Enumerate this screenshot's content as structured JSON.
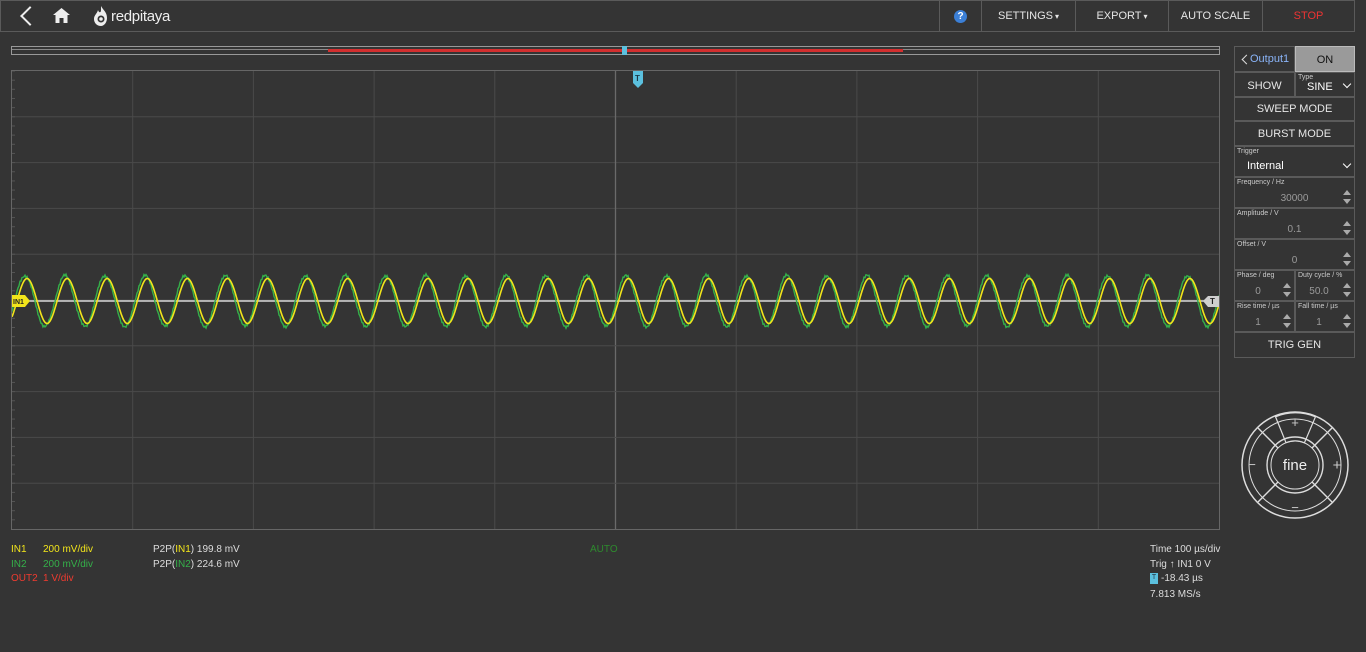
{
  "toolbar": {
    "logo_text": "redpitaya",
    "help_label": "?",
    "settings_label": "SETTINGS",
    "export_label": "EXPORT",
    "autoscale_label": "AUTO SCALE",
    "stop_label": "STOP",
    "caret": "▾"
  },
  "plot": {
    "trigger_marker_label": "T",
    "in1_marker_label": "IN1",
    "level_marker_label": "T",
    "mode_label": "AUTO",
    "colors": {
      "in1": "#f2e51b",
      "in2": "#34b04a",
      "out2": "#ef3b30",
      "grid": "#4a4a4a",
      "baseline": "#d8d8d8"
    }
  },
  "channels": [
    {
      "name": "IN1",
      "scale": "200 mV/div"
    },
    {
      "name": "IN2",
      "scale": "200 mV/div"
    },
    {
      "name": "OUT2",
      "scale": "1 V/div"
    }
  ],
  "measurements": [
    {
      "prefix": "P2P(",
      "channel": "IN1",
      "suffix": ")",
      "value": "199.8 mV"
    },
    {
      "prefix": "P2P(",
      "channel": "IN2",
      "suffix": ")",
      "value": "224.6 mV"
    }
  ],
  "timing": {
    "time_div": "Time 100 µs/div",
    "trig_prefix": "Trig",
    "trig_source": "IN1 0 V",
    "trig_arrow": "↑",
    "t_badge": "T",
    "offset": "-18.43 µs",
    "sample_rate": "7.813 MS/s"
  },
  "generator": {
    "output_label": "Output1",
    "on_label": "ON",
    "show_label": "SHOW",
    "type_label": "Type",
    "type_value": "SINE",
    "sweep_label": "SWEEP MODE",
    "burst_label": "BURST MODE",
    "trigger_label": "Trigger",
    "trigger_value": "Internal",
    "frequency_label": "Frequency / Hz",
    "frequency_value": "30000",
    "amplitude_label": "Amplitude / V",
    "amplitude_value": "0.1",
    "offset_label": "Offset / V",
    "offset_value": "0",
    "phase_label": "Phase / deg",
    "phase_value": "0",
    "duty_label": "Duty cycle / %",
    "duty_value": "50.0",
    "rise_label": "Rise time / µs",
    "rise_value": "1",
    "fall_label": "Fall time / µs",
    "fall_value": "1",
    "trig_gen_label": "TRIG GEN"
  },
  "dial": {
    "center_label": "fine",
    "up_label": "+",
    "down_label": "−",
    "left_label": "−",
    "right_label": "+"
  }
}
